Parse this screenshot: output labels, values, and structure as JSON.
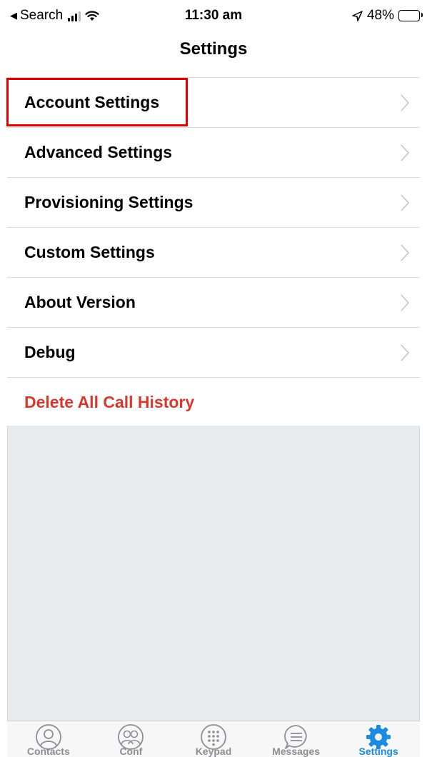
{
  "status_bar": {
    "back_label": "Search",
    "time": "11:30 am",
    "battery": "48%"
  },
  "nav": {
    "title": "Settings"
  },
  "settings_list": [
    {
      "label": "Account Settings"
    },
    {
      "label": "Advanced Settings"
    },
    {
      "label": "Provisioning Settings"
    },
    {
      "label": "Custom Settings"
    },
    {
      "label": "About Version"
    },
    {
      "label": "Debug"
    }
  ],
  "delete_history": {
    "label": "Delete All Call History",
    "color": "#d8372d"
  },
  "tab_bar": {
    "active_color": "#1a8be0",
    "tabs": [
      {
        "label": "Contacts",
        "icon": "contacts-icon"
      },
      {
        "label": "Conf",
        "icon": "conference-icon"
      },
      {
        "label": "Keypad",
        "icon": "keypad-icon"
      },
      {
        "label": "Messages",
        "icon": "messages-icon"
      },
      {
        "label": "Settings",
        "icon": "gear-icon",
        "active": true
      }
    ]
  }
}
